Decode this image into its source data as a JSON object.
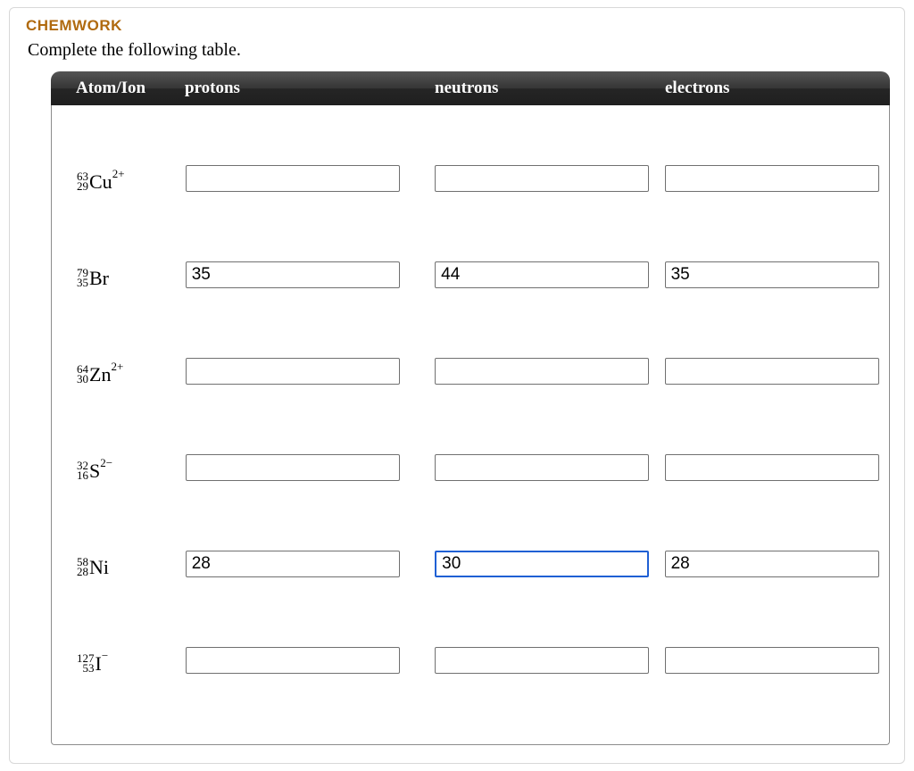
{
  "title": "CHEMWORK",
  "instruction": "Complete the following table.",
  "headers": {
    "atom": "Atom/Ion",
    "protons": "protons",
    "neutrons": "neutrons",
    "electrons": "electrons"
  },
  "rows": [
    {
      "mass": "63",
      "atnum": "29",
      "symbol": "Cu",
      "charge": "2+",
      "protons": "",
      "neutrons": "",
      "electrons": "",
      "focused": null
    },
    {
      "mass": "79",
      "atnum": "35",
      "symbol": "Br",
      "charge": "",
      "protons": "35",
      "neutrons": "44",
      "electrons": "35",
      "focused": null
    },
    {
      "mass": "64",
      "atnum": "30",
      "symbol": "Zn",
      "charge": "2+",
      "protons": "",
      "neutrons": "",
      "electrons": "",
      "focused": null
    },
    {
      "mass": "32",
      "atnum": "16",
      "symbol": "S",
      "charge": "2−",
      "protons": "",
      "neutrons": "",
      "electrons": "",
      "focused": null
    },
    {
      "mass": "58",
      "atnum": "28",
      "symbol": "Ni",
      "charge": "",
      "protons": "28",
      "neutrons": "30",
      "electrons": "28",
      "focused": "neutrons"
    },
    {
      "mass": "127",
      "atnum": "53",
      "symbol": "I",
      "charge": "−",
      "protons": "",
      "neutrons": "",
      "electrons": "",
      "focused": null
    }
  ]
}
